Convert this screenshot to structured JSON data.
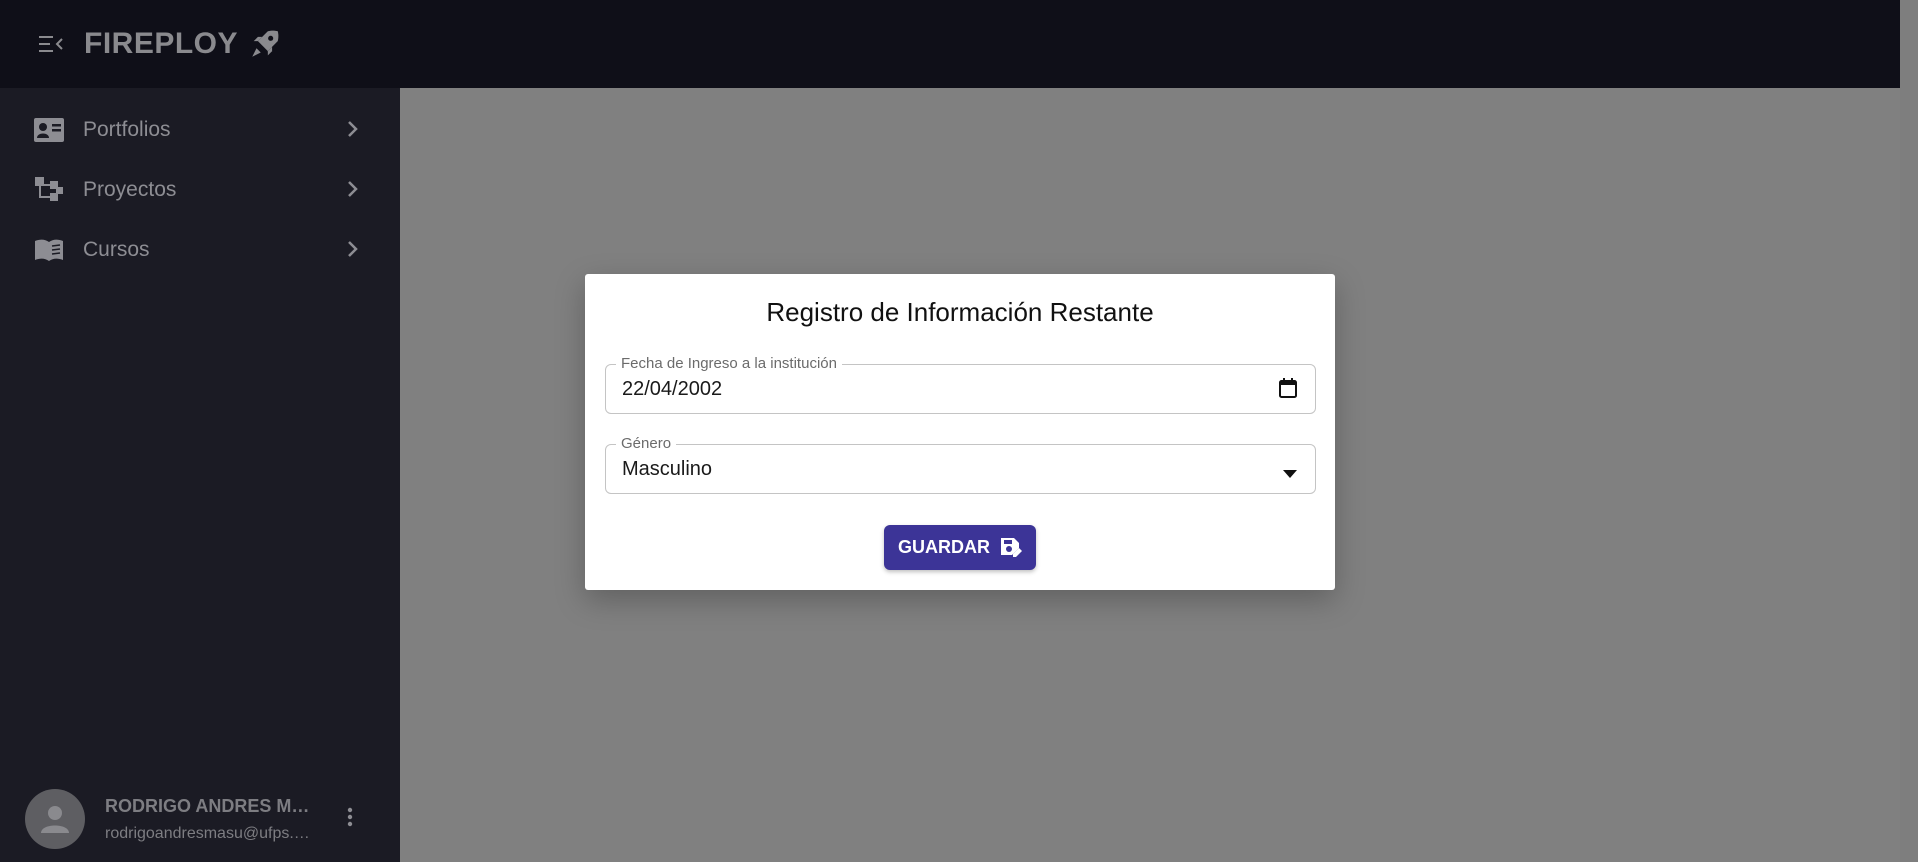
{
  "app": {
    "brand": "FIREPLOY",
    "menu_icon": "menu-collapse-icon",
    "brand_icon": "rocket-icon"
  },
  "sidebar": {
    "items": [
      {
        "label": "Portfolios",
        "icon": "contact-card-icon"
      },
      {
        "label": "Proyectos",
        "icon": "project-tree-icon"
      },
      {
        "label": "Cursos",
        "icon": "book-icon"
      }
    ],
    "user": {
      "name": "RODRIGO ANDRES MA...",
      "email": "rodrigoandresmasu@ufps.e..."
    }
  },
  "dialog": {
    "title": "Registro de Información Restante",
    "date_field": {
      "label": "Fecha de Ingreso a la institución",
      "value": "22/04/2002"
    },
    "gender_field": {
      "label": "Género",
      "value": "Masculino"
    },
    "save_label": "GUARDAR"
  },
  "colors": {
    "topbar": "#0f0f18",
    "sidebar": "#1b1b24",
    "backdrop": "#808080",
    "primary_button": "#3c3497"
  }
}
